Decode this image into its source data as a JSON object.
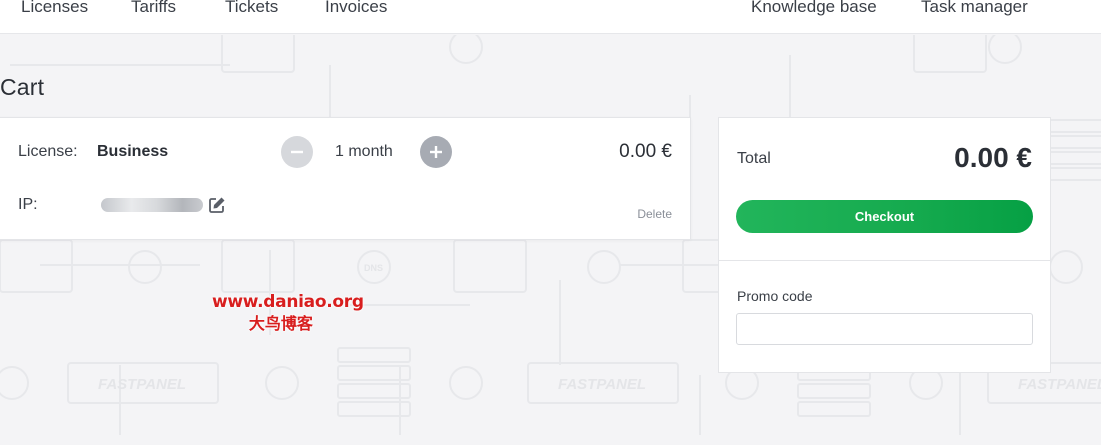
{
  "nav": {
    "items": [
      "Licenses",
      "Tariffs",
      "Tickets",
      "Invoices"
    ],
    "right_items": [
      "Knowledge base",
      "Task manager"
    ]
  },
  "page": {
    "title": "Cart"
  },
  "cart": {
    "license_label": "License:",
    "license_value": "Business",
    "period": "1 month",
    "price": "0.00 €",
    "ip_label": "IP:",
    "delete_label": "Delete"
  },
  "summary": {
    "total_label": "Total",
    "total_value": "0.00 €",
    "checkout_label": "Checkout",
    "promo_label": "Promo code",
    "promo_value": ""
  },
  "background": {
    "brand_text": "FASTPANEL",
    "dns_text": "DNS"
  },
  "watermark": {
    "line1": "www.daniao.org",
    "line2": "大鸟博客"
  },
  "colors": {
    "accent_green": "#15aa4e",
    "background": "#f4f4f6",
    "watermark_red": "#d81e1e"
  }
}
